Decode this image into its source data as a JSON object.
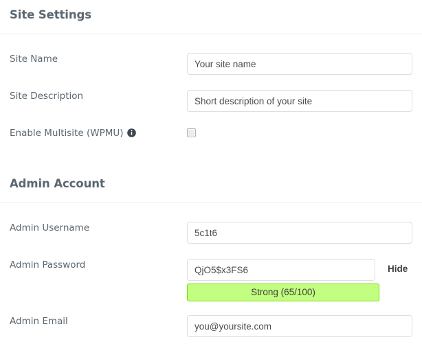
{
  "sections": [
    {
      "id": "site-settings",
      "title": "Site Settings",
      "fields": [
        {
          "label": "Site Name",
          "value": "Your site name"
        },
        {
          "label": "Site Description",
          "value": "Short description of your site"
        },
        {
          "label": "Enable Multisite (WPMU)",
          "icon": "info-icon",
          "checked": false
        }
      ]
    },
    {
      "id": "admin-account",
      "title": "Admin Account",
      "fields": [
        {
          "label": "Admin Username",
          "value": "5c1t6"
        },
        {
          "label": "Admin Password",
          "value": "QjO5$x3FS6",
          "toggle": "Hide"
        },
        {
          "label": "Admin Email",
          "value": "you@yoursite.com"
        }
      ]
    }
  ],
  "password_strength": {
    "text": "Strong (65/100)",
    "score": 65,
    "max": 100,
    "level": "Strong",
    "bar_color": "#c2fe7f",
    "border_color": "#6fe000"
  },
  "colors": {
    "label": "#5b6771",
    "heading": "#5b6771",
    "input_border": "#dedede",
    "divider": "#e9ebec",
    "input_text": "#4b4b4b"
  }
}
